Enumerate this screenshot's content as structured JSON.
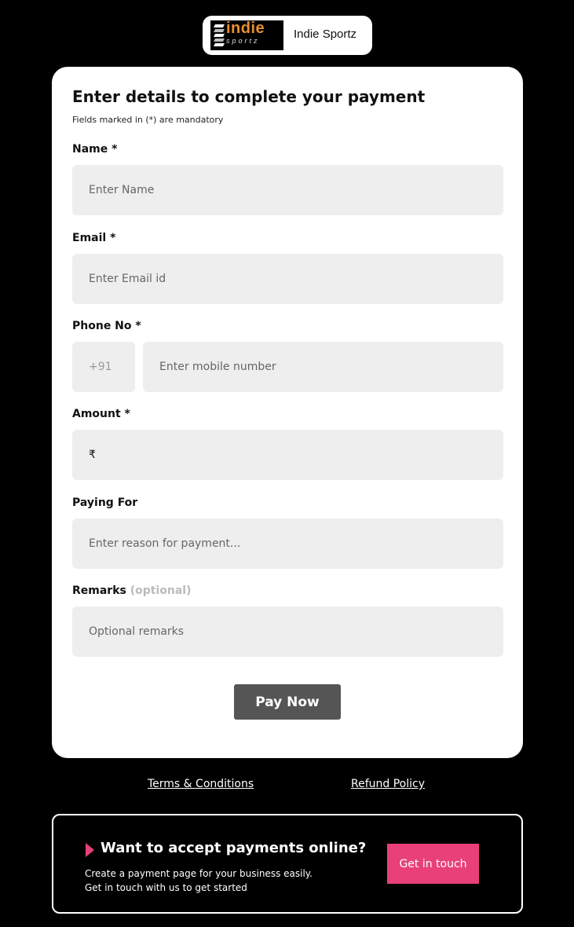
{
  "brand": {
    "logo_text_top": "indie",
    "logo_text_bottom": "sportz",
    "name": "Indie Sportz"
  },
  "form": {
    "title": "Enter details to complete your payment",
    "note": "Fields marked in (*) are mandatory",
    "name": {
      "label": "Name *",
      "placeholder": "Enter Name"
    },
    "email": {
      "label": "Email *",
      "placeholder": "Enter Email id"
    },
    "phone": {
      "label": "Phone No *",
      "country_code": "+91",
      "placeholder": "Enter mobile number"
    },
    "amount": {
      "label": "Amount *",
      "currency_symbol": "₹"
    },
    "paying_for": {
      "label": "Paying For",
      "placeholder": "Enter reason for payment..."
    },
    "remarks": {
      "label": "Remarks",
      "optional_tag": "(optional)",
      "placeholder": "Optional remarks"
    },
    "submit_label": "Pay Now"
  },
  "footer": {
    "terms_label": "Terms & Conditions",
    "refund_label": "Refund Policy"
  },
  "promo": {
    "title": "Want to accept payments online?",
    "line1": "Create a payment page for your business easily.",
    "line2": "Get in touch with us to get started",
    "button_label": "Get in touch"
  },
  "colors": {
    "background": "#000000",
    "accent": "#e94079",
    "logo_orange": "#e8902c",
    "button_gray": "#555555",
    "field_bg": "#eeeeee"
  }
}
